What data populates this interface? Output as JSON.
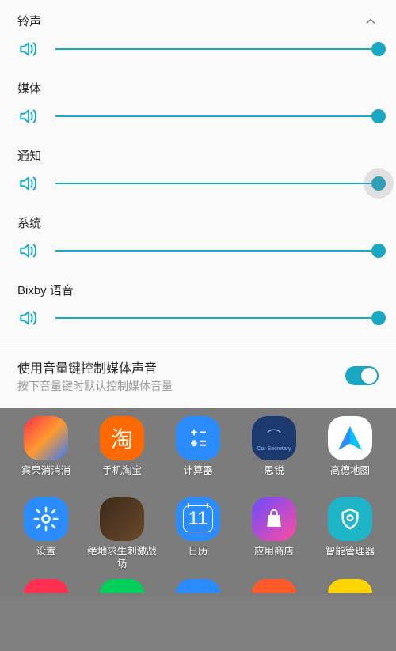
{
  "panel": {
    "sliders": [
      {
        "label": "铃声",
        "value": 100,
        "collapsible": true
      },
      {
        "label": "媒体",
        "value": 100
      },
      {
        "label": "通知",
        "value": 100,
        "active": true
      },
      {
        "label": "系统",
        "value": 100
      },
      {
        "label": "Bixby 语音",
        "value": 100
      }
    ],
    "toggle": {
      "title": "使用音量键控制媒体声音",
      "subtitle": "按下音量键时默认控制媒体音量",
      "on": true
    }
  },
  "home": {
    "row1": [
      {
        "label": "宾果消消消",
        "bg": "linear-gradient(135deg,#ff2e4e,#ff9a2e,#2e7bff)"
      },
      {
        "label": "手机淘宝",
        "bg": "#ff6a00",
        "glyph": "淘",
        "glyphColor": "#fff"
      },
      {
        "label": "计算器",
        "bg": "#2a8cff",
        "svg": "calc"
      },
      {
        "label": "思锐",
        "bg": "#1d3a6e",
        "glyph": "⌒",
        "glyphColor": "#8fb8ff",
        "sub": "Car Secretary"
      },
      {
        "label": "高德地图",
        "bg": "#fff",
        "svg": "amap"
      }
    ],
    "row2": [
      {
        "label": "设置",
        "bg": "#2a8cff",
        "svg": "gear"
      },
      {
        "label": "绝地求生刺激战场",
        "bg": "linear-gradient(135deg,#3a2a1a,#6b4a2a)",
        "glyph": ""
      },
      {
        "label": "日历",
        "bg": "#2a8cff",
        "glyph": "11",
        "glyphColor": "#fff",
        "cal": true
      },
      {
        "label": "应用商店",
        "bg": "linear-gradient(135deg,#6a4cff,#ff4ca0)",
        "svg": "bag"
      },
      {
        "label": "智能管理器",
        "bg": "#1fb5c9",
        "svg": "shield"
      }
    ],
    "row3": [
      {
        "bg": "#ff3050"
      },
      {
        "bg": "#00d05a"
      },
      {
        "bg": "#2a8cff"
      },
      {
        "bg": "#ff5a2a"
      },
      {
        "bg": "#ffd400"
      }
    ]
  },
  "colors": {
    "accent": "#19a7c4"
  }
}
